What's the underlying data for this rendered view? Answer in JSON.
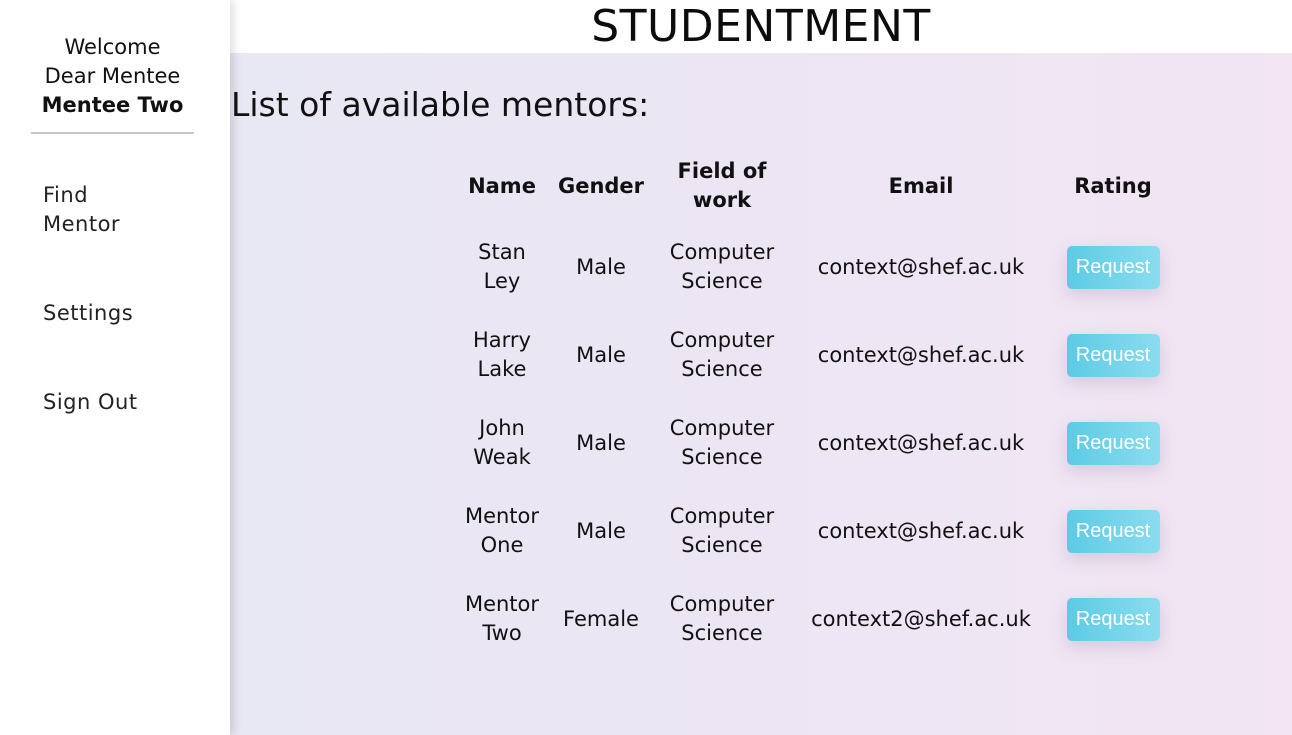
{
  "sidebar": {
    "welcome_line1": "Welcome",
    "welcome_line2": "Dear Mentee",
    "user_name": "Mentee Two",
    "nav": {
      "find_mentor": "Find Mentor",
      "settings": "Settings",
      "sign_out": "Sign Out"
    }
  },
  "header": {
    "brand": "STUDENTMENT"
  },
  "main": {
    "heading": "List of available mentors:",
    "columns": {
      "name": "Name",
      "gender": "Gender",
      "field": "Field of work",
      "email": "Email",
      "rating": "Rating"
    },
    "rows": [
      {
        "name": "Stan Ley",
        "gender": "Male",
        "field": "Computer Science",
        "email": "context@shef.ac.uk",
        "action": "Request"
      },
      {
        "name": "Harry Lake",
        "gender": "Male",
        "field": "Computer Science",
        "email": "context@shef.ac.uk",
        "action": "Request"
      },
      {
        "name": "John Weak",
        "gender": "Male",
        "field": "Computer Science",
        "email": "context@shef.ac.uk",
        "action": "Request"
      },
      {
        "name": "Mentor One",
        "gender": "Male",
        "field": "Computer Science",
        "email": "context@shef.ac.uk",
        "action": "Request"
      },
      {
        "name": "Mentor Two",
        "gender": "Female",
        "field": "Computer Science",
        "email": "context2@shef.ac.uk",
        "action": "Request"
      }
    ]
  },
  "colors": {
    "button_start": "#5ccbe4",
    "button_end": "#8bdcf0",
    "background_left": "#e8e7f4",
    "background_right": "#f3e5f3"
  }
}
